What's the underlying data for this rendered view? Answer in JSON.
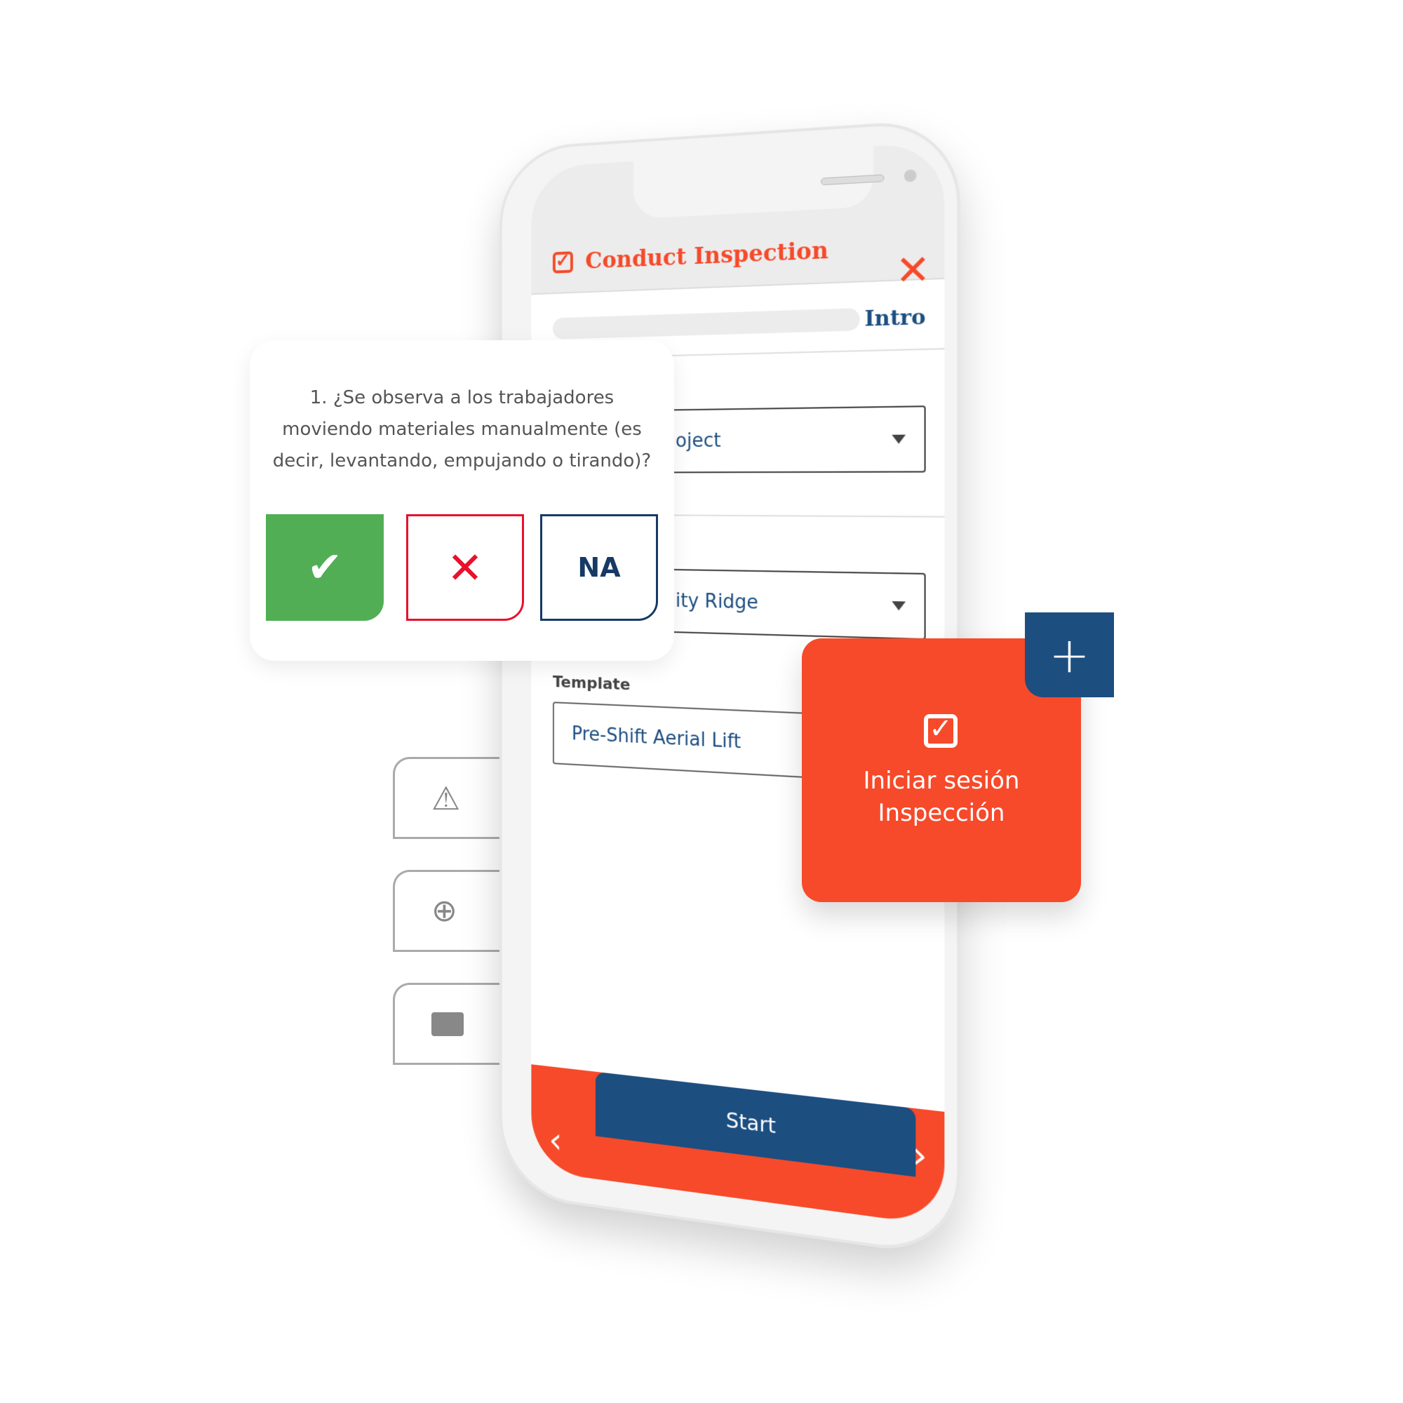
{
  "header": {
    "title": "Conduct Inspection",
    "close_icon": "close-icon",
    "step": "Intro"
  },
  "form": {
    "field1_value": "oject",
    "field2_value": "ity Ridge",
    "template_label": "Template",
    "template_value": "Pre-Shift Aerial Lift"
  },
  "footer": {
    "start_label": "Start"
  },
  "question": {
    "text": "1. ¿Se observa a los trabajadores moviendo materiales manualmente (es decir, levantando, empujando o tirando)?",
    "yes_icon": "check-icon",
    "no_icon": "x-icon",
    "na_label": "NA"
  },
  "side_actions": [
    "warning-icon",
    "zoom-in-icon",
    "comment-icon"
  ],
  "promo": {
    "line1": "Iniciar sesión",
    "line2": "Inspección",
    "plus": "+"
  },
  "colors": {
    "orange": "#F64A2A",
    "navy": "#1C4E80",
    "green": "#52AE55",
    "red": "#E8112D"
  }
}
